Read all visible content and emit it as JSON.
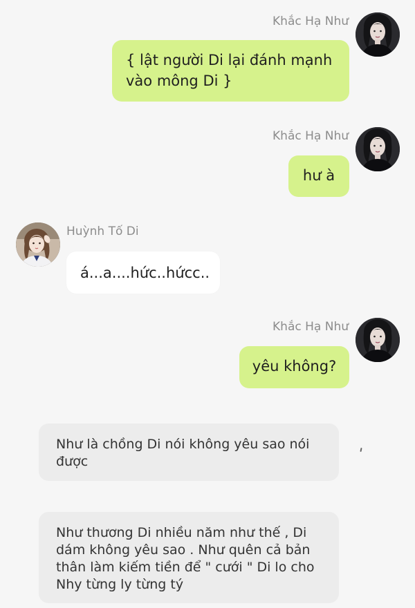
{
  "users": {
    "nhu": {
      "name": "Khắc Hạ Như",
      "avatar_icon": "dark-haired-woman-avatar"
    },
    "di": {
      "name": "Huỳnh Tố Di",
      "avatar_icon": "girl-with-braids-avatar"
    }
  },
  "messages": [
    {
      "sender": "Khắc Hạ Như",
      "text": "{ lật người Di lại đánh mạnh vào mông Di }"
    },
    {
      "sender": "Khắc Hạ Như",
      "text": "hư à"
    },
    {
      "sender": "Huỳnh Tố Di",
      "text": "á...a....hức..hứcc.."
    },
    {
      "sender": "Khắc Hạ Như",
      "text": "yêu không?"
    }
  ],
  "narration": [
    {
      "text": "Như là chồng Di nói không yêu sao nói được"
    },
    {
      "text": "Như thương Di nhiều năm như thế , Di dám không yêu sao . Như quên cả bản thân làm kiếm tiền để \" cưới \" Di lo cho Nhy từng ly từng tý"
    }
  ],
  "colors": {
    "background": "#f6f6f6",
    "sent_bubble": "#d6f28c",
    "received_bubble": "#ffffff",
    "narration_bubble": "#ececec",
    "name_text": "#8c8c8c"
  }
}
